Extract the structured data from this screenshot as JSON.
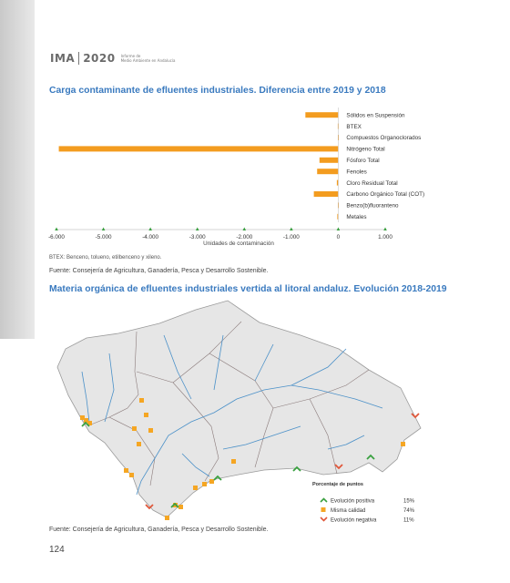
{
  "header": {
    "logo_text": "IMA",
    "year": "2020",
    "subtitle_line1": "Informe de",
    "subtitle_line2": "Medio Ambiente en Andalucía"
  },
  "section1": {
    "title": "Carga contaminante de efluentes industriales. Diferencia entre 2019 y 2018",
    "note": "BTEX: Benceno, tolueno, etilbenceno y xileno.",
    "source": "Fuente: Consejería de Agricultura, Ganadería, Pesca y Desarrollo Sostenible."
  },
  "chart_data": {
    "type": "bar",
    "orientation": "horizontal",
    "categories": [
      "Sólidos en Suspensión",
      "BTEX",
      "Compuestos Organoclorados",
      "Nitrógeno Total",
      "Fósforo Total",
      "Fenoles",
      "Cloro Residual Total",
      "Carbono Orgánico Total (COT)",
      "Benzo(b)fluoranteno",
      "Metales"
    ],
    "values": [
      -700,
      -10,
      -5,
      -5950,
      -400,
      -450,
      -30,
      -520,
      -5,
      -20
    ],
    "xlabel": "Unidades de contaminación",
    "xlim": [
      -6000,
      1000
    ],
    "xticks": [
      -6000,
      -5000,
      -4000,
      -3000,
      -2000,
      -1000,
      0,
      1000
    ],
    "xtick_labels": [
      "-6.000",
      "-5.000",
      "-4.000",
      "-3.000",
      "-2.000",
      "-1.000",
      "0",
      "1.000"
    ],
    "bar_color": "#f39c1f"
  },
  "section2": {
    "title": "Materia orgánica de efluentes industriales vertida al litoral andaluz. Evolución 2018-2019",
    "source": "Fuente: Consejería de Agricultura, Ganadería, Pesca y Desarrollo Sostenible."
  },
  "map": {
    "legend_title": "Porcentaje de puntos",
    "legend": [
      {
        "label": "Evolución positiva",
        "value": "15%",
        "color": "#3aa040",
        "icon": "chevron-up-icon"
      },
      {
        "label": "Misma calidad",
        "value": "74%",
        "color": "#f5a623",
        "icon": "square-icon"
      },
      {
        "label": "Evolución negativa",
        "value": "11%",
        "color": "#e0573a",
        "icon": "chevron-down-icon"
      }
    ]
  },
  "page_number": "124"
}
